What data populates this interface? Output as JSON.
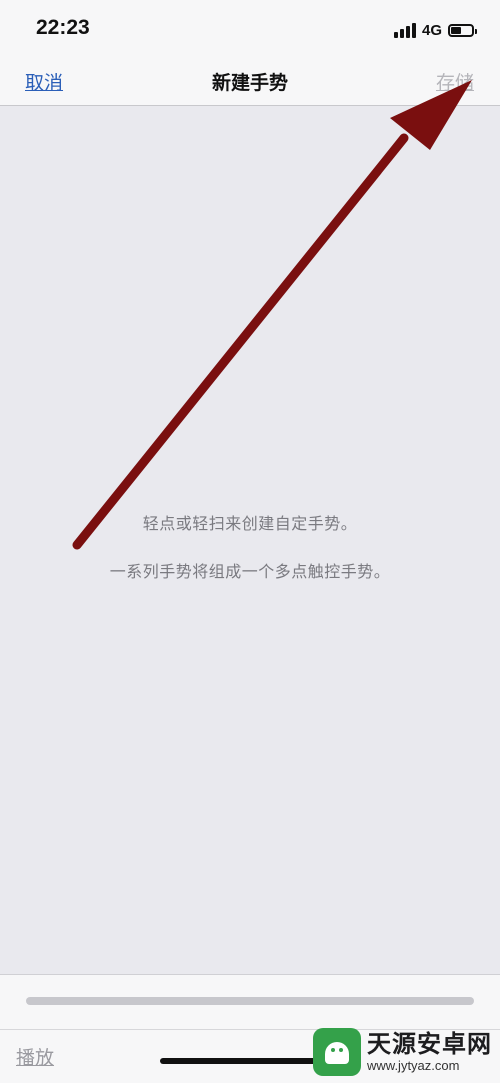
{
  "status_bar": {
    "time": "22:23",
    "network": "4G",
    "icons": [
      "signal-icon",
      "battery-icon"
    ]
  },
  "nav": {
    "cancel_label": "取消",
    "title": "新建手势",
    "save_label": "存储"
  },
  "canvas": {
    "hint_line_1": "轻点或轻扫来创建自定手势。",
    "hint_line_2": "一系列手势将组成一个多点触控手势。"
  },
  "bottom": {
    "play_label": "播放",
    "progress_value": 0
  },
  "watermark": {
    "name": "天源安卓网",
    "url": "www.jytyaz.com"
  },
  "colors": {
    "link_blue": "#2b5fb8",
    "disabled_gray": "#b5b5ba",
    "arrow_red": "#7a0f0f",
    "canvas_bg": "#e9e9ee",
    "watermark_green": "#34a14a"
  }
}
